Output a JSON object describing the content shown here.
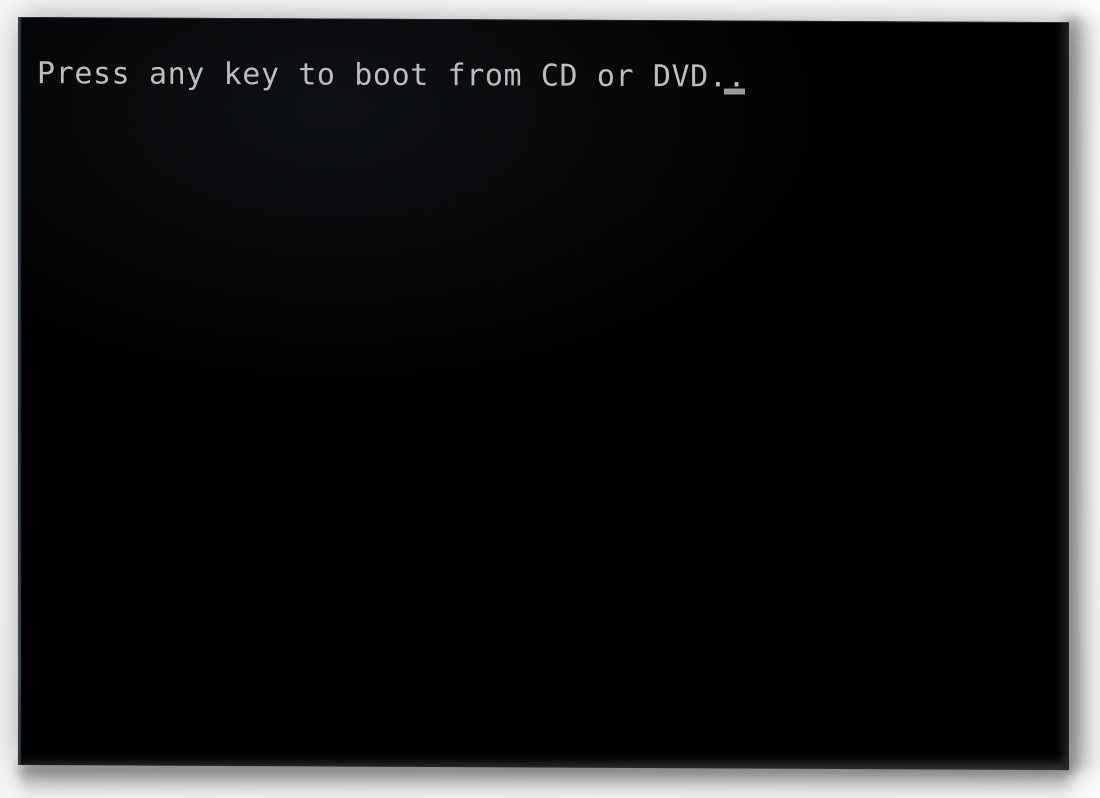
{
  "screen": {
    "kind": "bios-boot-prompt",
    "background_color": "#000000",
    "text_color": "#bdbdbd",
    "page_background_color": "#fbfbfb",
    "bezel_edge_color": "#2b3a47",
    "caret_color": "#9b9b9b"
  },
  "console": {
    "prompt_line": "Press any key to boot from CD or DVD..",
    "caret_glyph": "_",
    "lines": [
      "Press any key to boot from CD or DVD.."
    ]
  }
}
